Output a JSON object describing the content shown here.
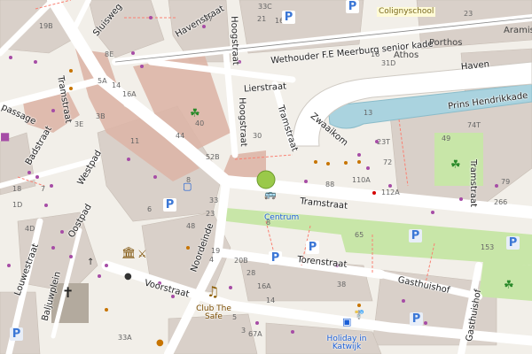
{
  "streets": {
    "tramstraat_main": "Tramstraat",
    "tramstraat_left": "Tramstraat",
    "tramstraat_right": "Tramstraat",
    "haven": "Haven",
    "prins_hendrikkade": "Prins Hendrikkade",
    "wethouder": "Wethouder F.E Meerburg senior kade",
    "lierstraat": "Lierstraat",
    "tramstraat_small": "Tramstraat",
    "zwaaikom": "Zwaaikom",
    "hoogstraat_1": "Hoogstraat",
    "hoogstraat_2": "Hoogstraat",
    "havenstraat": "Havenstraat",
    "sluisweg": "Sluisweg",
    "westpad": "Westpad",
    "badstraat": "Badstraat",
    "oostpad": "Oostpad",
    "louwestraat": "Louwestraat",
    "baljuwplein": "Baljuwplein",
    "voorstraat": "Voorstraat",
    "noordeinde": "Noordeinde",
    "torenstraat": "Torenstraat",
    "gasthuishof": "Gasthuishof",
    "gasthuishof_v": "Gasthuishof",
    "passage": "passage"
  },
  "pois": {
    "centrum": "Centrum",
    "club_the_safe": "Club The Safe",
    "holiday_in_katwijk": "Holiday in Katwijk",
    "colignyschool": "Colignyschool",
    "porthos": "Porthos",
    "athos": "Athos",
    "aramis": "Aramis"
  },
  "house_numbers": {
    "n33c": "33C",
    "n21": "21",
    "n23": "23",
    "n19b": "19B",
    "n8e": "8E",
    "n5a": "5A",
    "n16a": "16A",
    "n14": "14",
    "n3b": "3B",
    "n3e": "3E",
    "n11": "11",
    "n44": "44",
    "n52b": "52B",
    "n30a": "30",
    "n40": "40",
    "n13": "13",
    "n23t": "23T",
    "n72": "72",
    "n88": "88",
    "n110a": "110A",
    "n112a": "112A",
    "n49": "49",
    "n74t": "74T",
    "n79": "79",
    "n266": "266",
    "n18": "18",
    "n7": "7",
    "n1d": "1D",
    "n4d": "4D",
    "n48": "48",
    "n33": "33",
    "n16a2": "16A",
    "n20b": "20B",
    "n28": "28",
    "n65": "65",
    "n153": "153",
    "n38": "38",
    "n19": "19",
    "n3": "3",
    "n5": "5",
    "n8": "8",
    "n4": "4",
    "n14b": "14",
    "n33a": "33A",
    "n67a": "67A",
    "n37": "37",
    "n31d": "31D",
    "n8b": "8",
    "n16": "16",
    "n23b": "23",
    "n6": "6",
    "n16c": "16"
  },
  "icons": [
    "parking-icon",
    "bus-stop-icon",
    "cinema-icon",
    "museum-icon",
    "place-of-worship-icon",
    "playground-icon",
    "bicycle-parking-icon",
    "atm-icon",
    "hotel-icon",
    "music-venue-icon"
  ],
  "colors": {
    "background": "#f2efe9",
    "building": "#d9d0c9",
    "pedestrian": "#ddb6a8",
    "park": "#c8e6a8",
    "water": "#aad3df",
    "road": "#ffffff",
    "parking_blue": "#3b77d6"
  }
}
